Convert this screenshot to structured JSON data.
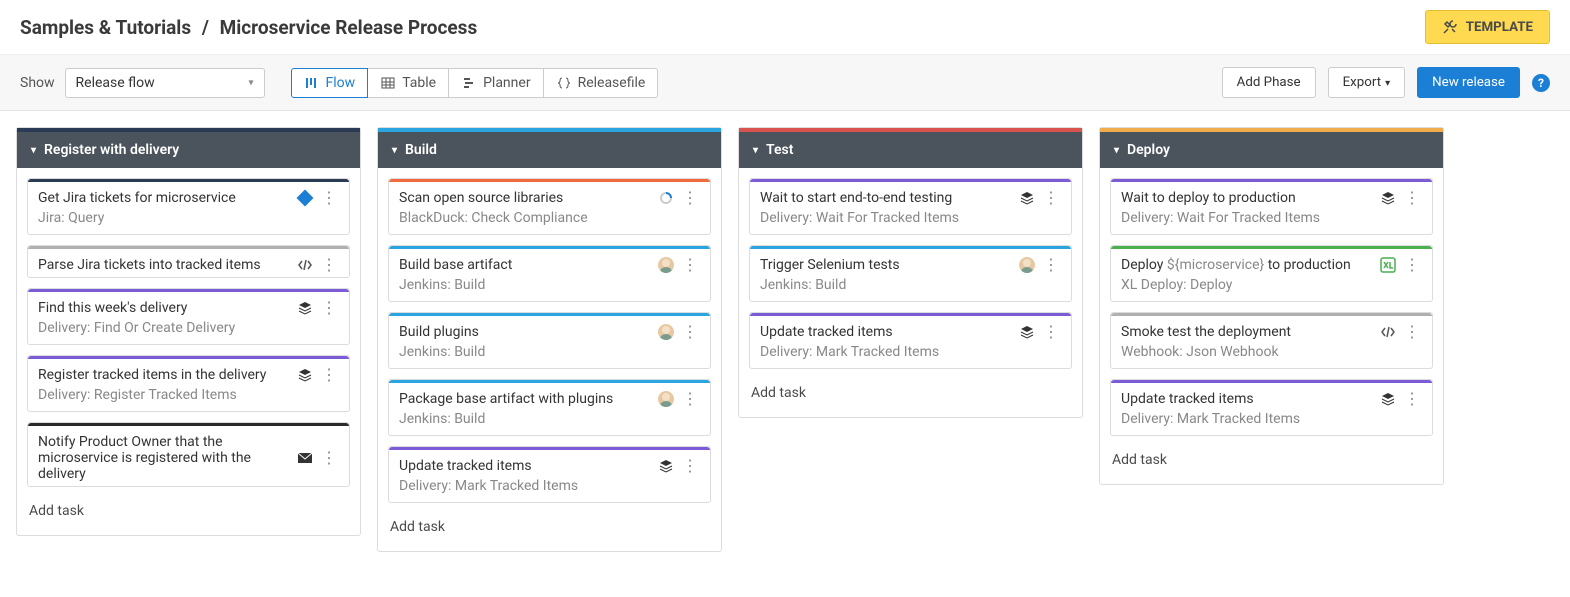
{
  "breadcrumb": {
    "parent": "Samples & Tutorials",
    "sep": "/",
    "current": "Microservice Release Process"
  },
  "template_button": "TEMPLATE",
  "toolbar": {
    "show_label": "Show",
    "show_value": "Release flow",
    "views": {
      "flow": "Flow",
      "table": "Table",
      "planner": "Planner",
      "releasefile": "Releasefile"
    },
    "add_phase": "Add Phase",
    "export": "Export",
    "new_release": "New release"
  },
  "add_task_label": "Add task",
  "phases": [
    {
      "name": "Register with delivery",
      "accent": "c-navy",
      "tasks": [
        {
          "accent": "c-navy",
          "title": "Get Jira tickets for microservice",
          "sub": "Jira: Query",
          "icon": "diamond"
        },
        {
          "accent": "c-gray",
          "title": "Parse Jira tickets into tracked items",
          "sub": "",
          "icon": "code"
        },
        {
          "accent": "c-purple",
          "title": "Find this week's delivery",
          "sub": "Delivery: Find Or Create Delivery",
          "icon": "stack"
        },
        {
          "accent": "c-purple",
          "title": "Register tracked items in the delivery",
          "sub": "Delivery: Register Tracked Items",
          "icon": "stack"
        },
        {
          "accent": "c-black",
          "title": "Notify Product Owner that the microservice is registered with the delivery",
          "sub": "",
          "icon": "mail"
        }
      ]
    },
    {
      "name": "Build",
      "accent": "c-blue",
      "tasks": [
        {
          "accent": "c-orange",
          "title": "Scan open source libraries",
          "sub": "BlackDuck: Check Compliance",
          "icon": "spinner"
        },
        {
          "accent": "c-blue",
          "title": "Build base artifact",
          "sub": "Jenkins: Build",
          "icon": "avatar"
        },
        {
          "accent": "c-blue",
          "title": "Build plugins",
          "sub": "Jenkins: Build",
          "icon": "avatar"
        },
        {
          "accent": "c-blue",
          "title": "Package base artifact with plugins",
          "sub": "Jenkins: Build",
          "icon": "avatar"
        },
        {
          "accent": "c-purple",
          "title": "Update tracked items",
          "sub": "Delivery: Mark Tracked Items",
          "icon": "stack"
        }
      ]
    },
    {
      "name": "Test",
      "accent": "c-red",
      "tasks": [
        {
          "accent": "c-purple",
          "title": "Wait to start end-to-end testing",
          "sub": "Delivery: Wait For Tracked Items",
          "icon": "stack"
        },
        {
          "accent": "c-blue",
          "title": "Trigger Selenium tests",
          "sub": "Jenkins: Build",
          "icon": "avatar"
        },
        {
          "accent": "c-purple",
          "title": "Update tracked items",
          "sub": "Delivery: Mark Tracked Items",
          "icon": "stack"
        }
      ]
    },
    {
      "name": "Deploy",
      "accent": "c-yellow",
      "tasks": [
        {
          "accent": "c-purple",
          "title": "Wait to deploy to production",
          "sub": "Delivery: Wait For Tracked Items",
          "icon": "stack"
        },
        {
          "accent": "c-green",
          "title_parts": [
            "Deploy ",
            "${microservice}",
            " to production"
          ],
          "sub": "XL Deploy: Deploy",
          "icon": "xl"
        },
        {
          "accent": "c-gray",
          "title": "Smoke test the deployment",
          "sub": "Webhook: Json Webhook",
          "icon": "code"
        },
        {
          "accent": "c-purple",
          "title": "Update tracked items",
          "sub": "Delivery: Mark Tracked Items",
          "icon": "stack"
        }
      ]
    }
  ]
}
